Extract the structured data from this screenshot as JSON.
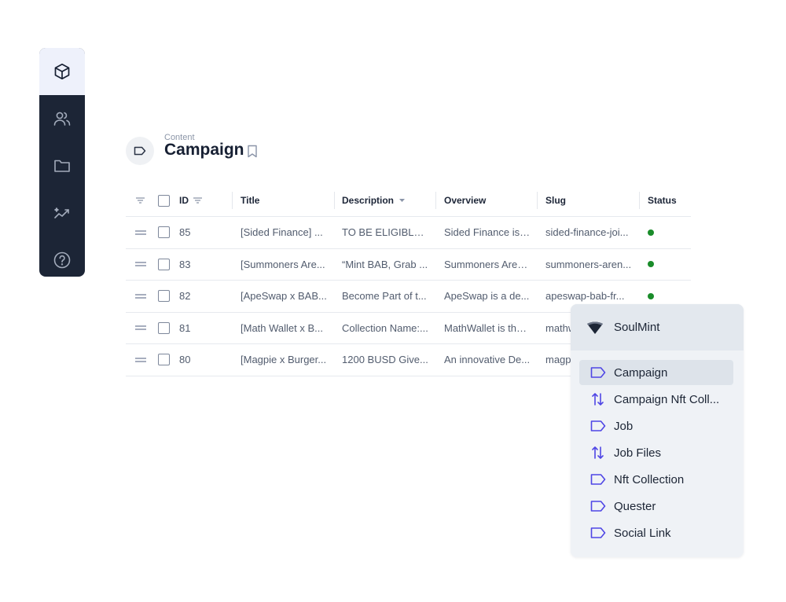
{
  "sidebar": {
    "items": [
      {
        "icon": "cube-icon",
        "active": true
      },
      {
        "icon": "users-icon"
      },
      {
        "icon": "folder-icon"
      },
      {
        "icon": "analytics-icon"
      },
      {
        "icon": "help-icon"
      }
    ]
  },
  "header": {
    "breadcrumb": "Content",
    "title": "Campaign"
  },
  "table": {
    "columns": [
      "ID",
      "Title",
      "Description",
      "Overview",
      "Slug",
      "Status"
    ],
    "rows": [
      {
        "id": "85",
        "title": "[Sided Finance] ...",
        "description": "TO BE ELIGIBLE, ...",
        "overview": "Sided Finance is ...",
        "slug": "sided-finance-joi...",
        "status": "active"
      },
      {
        "id": "83",
        "title": "[Summoners Are...",
        "description": "“Mint BAB, Grab ...",
        "overview": "Summoners Aren...",
        "slug": "summoners-aren...",
        "status": "active"
      },
      {
        "id": "82",
        "title": "[ApeSwap x BAB...",
        "description": "Become Part of t...",
        "overview": "ApeSwap is a de...",
        "slug": "apeswap-bab-fr...",
        "status": "active"
      },
      {
        "id": "81",
        "title": "[Math Wallet x B...",
        "description": "Collection Name:...",
        "overview": "MathWallet is the...",
        "slug": "mathw",
        "status": ""
      },
      {
        "id": "80",
        "title": "[Magpie x Burger...",
        "description": "1200 BUSD Give...",
        "overview": "An innovative De...",
        "slug": "magp",
        "status": ""
      }
    ]
  },
  "dropdown": {
    "project": "SoulMint",
    "items": [
      {
        "label": "Campaign",
        "icon": "tag-icon",
        "selected": true
      },
      {
        "label": "Campaign Nft Coll...",
        "icon": "relation-icon"
      },
      {
        "label": "Job",
        "icon": "tag-icon"
      },
      {
        "label": "Job Files",
        "icon": "relation-icon"
      },
      {
        "label": "Nft Collection",
        "icon": "tag-icon"
      },
      {
        "label": "Quester",
        "icon": "tag-icon"
      },
      {
        "label": "Social Link",
        "icon": "tag-icon"
      }
    ]
  },
  "colors": {
    "sidebar_bg": "#1c2536",
    "accent": "#4f46e5",
    "status_green": "#1a8c2a"
  }
}
